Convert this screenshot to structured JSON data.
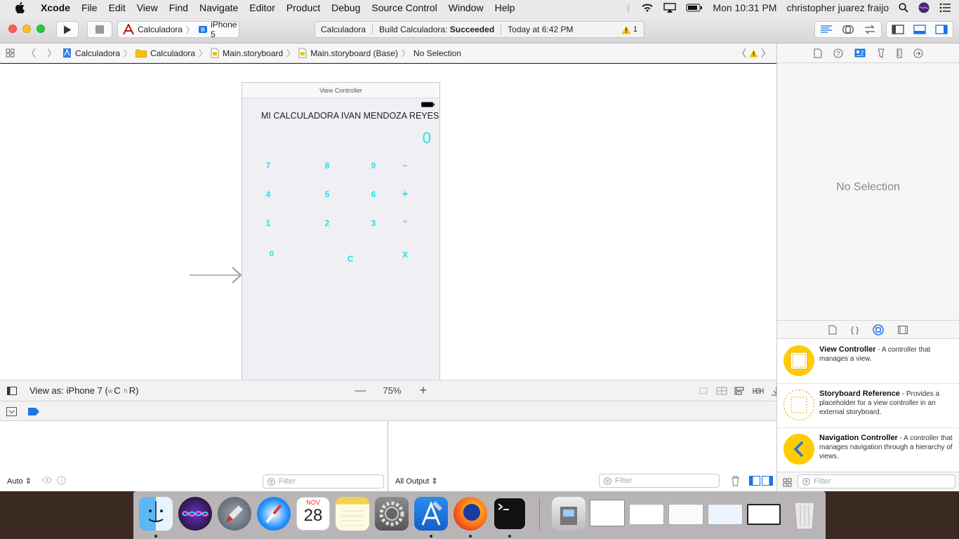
{
  "menubar": {
    "app": "Xcode",
    "items": [
      "File",
      "Edit",
      "View",
      "Find",
      "Navigate",
      "Editor",
      "Product",
      "Debug",
      "Source Control",
      "Window",
      "Help"
    ],
    "clock": "Mon 10:31 PM",
    "user": "christopher juarez fraijo"
  },
  "toolbar": {
    "scheme": "Calculadora",
    "device": "iPhone 5",
    "activity_project": "Calculadora",
    "activity_status_prefix": "Build Calculadora: ",
    "activity_status": "Succeeded",
    "activity_time": "Today at 6:42 PM",
    "warning_count": "1"
  },
  "jumpbar": {
    "crumbs": [
      "Calculadora",
      "Calculadora",
      "Main.storyboard",
      "Main.storyboard (Base)",
      "No Selection"
    ]
  },
  "scene": {
    "title": "View Controller",
    "label": "MI CALCULADORA IVAN MENDOZA REYES",
    "display": "0",
    "keys": [
      {
        "text": "7"
      },
      {
        "text": "8"
      },
      {
        "text": "9"
      },
      {
        "text": "−"
      },
      {
        "text": "4"
      },
      {
        "text": "5"
      },
      {
        "text": "6"
      },
      {
        "text": "+"
      },
      {
        "text": "1"
      },
      {
        "text": "2"
      },
      {
        "text": "3"
      },
      {
        "text": "÷"
      },
      {
        "text": "0"
      },
      {
        "text": "C"
      },
      {
        "text": "X"
      }
    ]
  },
  "storyboard_bar": {
    "view_as": "View as: iPhone 7 (",
    "size_class_w": "w",
    "size_class_c": "C",
    "size_class_h": "h",
    "size_class_r": "R)",
    "zoom": "75%"
  },
  "debug": {
    "auto": "Auto",
    "filter_placeholder": "Filter",
    "output": "All Output",
    "output_filter_placeholder": "Filter"
  },
  "inspector": {
    "no_selection": "No Selection"
  },
  "library": {
    "items": [
      {
        "title": "View Controller",
        "desc": " - A controller that manages a view."
      },
      {
        "title": "Storyboard Reference",
        "desc": " - Provides a placeholder for a view controller in an external storyboard."
      },
      {
        "title": "Navigation Controller",
        "desc": " - A controller that manages navigation through a hierarchy of views."
      }
    ],
    "filter_placeholder": "Filter"
  },
  "dock": {
    "calendar_month": "NOV",
    "calendar_day": "28",
    "apps": [
      "finder-icon",
      "siri-icon",
      "launchpad-icon",
      "safari-icon",
      "calendar-icon",
      "notes-icon",
      "system-preferences-icon",
      "xcode-icon",
      "firefox-icon",
      "terminal-icon",
      "preview-icon",
      "window-thumbnail-icon",
      "window-thumbnail-icon",
      "window-thumbnail-icon",
      "window-thumbnail-icon",
      "window-thumbnail-icon",
      "trash-icon"
    ]
  },
  "colors": {
    "accent": "#1b73e8",
    "key_text": "#1ee4e8",
    "warning": "#f5c400",
    "library_icon": "#ffcc00"
  }
}
